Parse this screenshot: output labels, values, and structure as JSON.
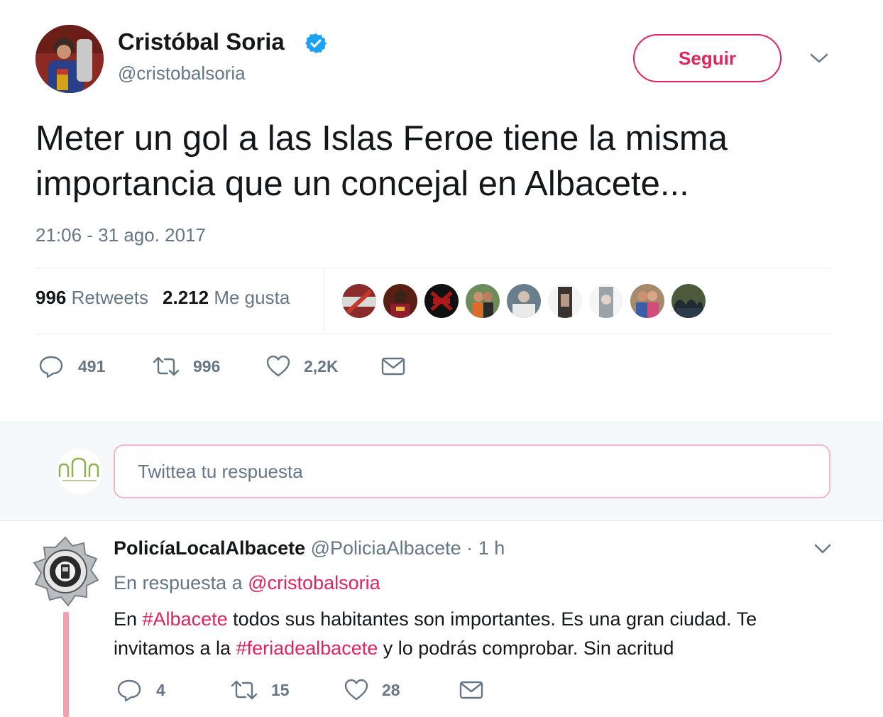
{
  "tweet": {
    "display_name": "Cristóbal Soria",
    "verified_icon": "verified-badge-icon",
    "handle": "@cristobalsoria",
    "follow_label": "Seguir",
    "text": "Meter un gol a las Islas Feroe tiene la misma importancia que un concejal en Albacete...",
    "timestamp": "21:06 - 31 ago. 2017",
    "stats": {
      "retweets_count": "996",
      "retweets_label": "Retweets",
      "likes_count": "2.212",
      "likes_label": "Me gusta"
    },
    "liker_avatar_count_visible": 9,
    "actions": {
      "replies": "491",
      "retweets": "996",
      "likes": "2,2K"
    }
  },
  "reply_box": {
    "placeholder": "Twittea tu respuesta"
  },
  "reply": {
    "display_name": "PolicíaLocalAlbacete",
    "handle": "@PoliciaAlbacete",
    "separator": "·",
    "time": "1 h",
    "in_reply_prefix": "En respuesta a",
    "in_reply_handle": "@cristobalsoria",
    "text_parts": {
      "p1": "En ",
      "tag1": "#Albacete",
      "p2": " todos sus habitantes son importantes. Es una gran ciudad. Te invitamos a la ",
      "tag2": "#feriadealbacete",
      "p3": " y lo podrás comprobar. Sin acritud"
    },
    "actions": {
      "replies": "4",
      "retweets": "15",
      "likes": "28"
    }
  },
  "colors": {
    "accent": "#e0245e",
    "muted": "#657786",
    "verified": "#1da1f2",
    "thread_line": "#f3a1ac"
  }
}
